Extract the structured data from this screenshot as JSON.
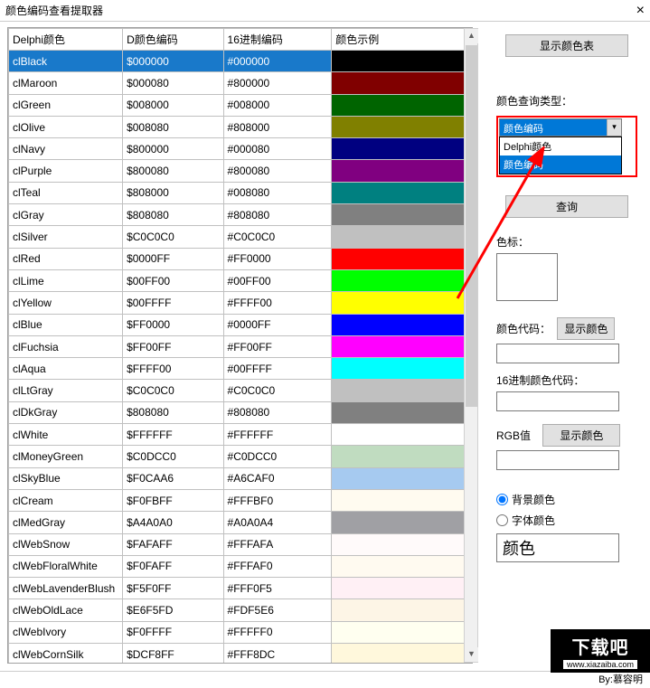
{
  "window": {
    "title": "颜色编码查看提取器",
    "close": "×"
  },
  "table": {
    "headers": [
      "Delphi颜色",
      "D颜色编码",
      "16进制编码",
      "颜色示例"
    ],
    "rows": [
      {
        "name": "clBlack",
        "d": "$000000",
        "hex": "#000000",
        "color": "#000000",
        "selected": true
      },
      {
        "name": "clMaroon",
        "d": "$000080",
        "hex": "#800000",
        "color": "#800000"
      },
      {
        "name": "clGreen",
        "d": "$008000",
        "hex": "#008000",
        "color": "#006400"
      },
      {
        "name": "clOlive",
        "d": "$008080",
        "hex": "#808000",
        "color": "#808000"
      },
      {
        "name": "clNavy",
        "d": "$800000",
        "hex": "#000080",
        "color": "#000080"
      },
      {
        "name": "clPurple",
        "d": "$800080",
        "hex": "#800080",
        "color": "#800080"
      },
      {
        "name": "clTeal",
        "d": "$808000",
        "hex": "#008080",
        "color": "#008080"
      },
      {
        "name": "clGray",
        "d": "$808080",
        "hex": "#808080",
        "color": "#808080"
      },
      {
        "name": "clSilver",
        "d": "$C0C0C0",
        "hex": "#C0C0C0",
        "color": "#C0C0C0"
      },
      {
        "name": "clRed",
        "d": "$0000FF",
        "hex": "#FF0000",
        "color": "#FF0000"
      },
      {
        "name": "clLime",
        "d": "$00FF00",
        "hex": "#00FF00",
        "color": "#00FF00"
      },
      {
        "name": "clYellow",
        "d": "$00FFFF",
        "hex": "#FFFF00",
        "color": "#FFFF00"
      },
      {
        "name": "clBlue",
        "d": "$FF0000",
        "hex": "#0000FF",
        "color": "#0000FF"
      },
      {
        "name": "clFuchsia",
        "d": "$FF00FF",
        "hex": "#FF00FF",
        "color": "#FF00FF"
      },
      {
        "name": "clAqua",
        "d": "$FFFF00",
        "hex": "#00FFFF",
        "color": "#00FFFF"
      },
      {
        "name": "clLtGray",
        "d": "$C0C0C0",
        "hex": "#C0C0C0",
        "color": "#C0C0C0"
      },
      {
        "name": "clDkGray",
        "d": "$808080",
        "hex": "#808080",
        "color": "#808080"
      },
      {
        "name": "clWhite",
        "d": "$FFFFFF",
        "hex": "#FFFFFF",
        "color": "#FFFFFF"
      },
      {
        "name": "clMoneyGreen",
        "d": "$C0DCC0",
        "hex": "#C0DCC0",
        "color": "#C0DCC0"
      },
      {
        "name": "clSkyBlue",
        "d": "$F0CAA6",
        "hex": "#A6CAF0",
        "color": "#A6CAF0"
      },
      {
        "name": "clCream",
        "d": "$F0FBFF",
        "hex": "#FFFBF0",
        "color": "#FFFBF0"
      },
      {
        "name": "clMedGray",
        "d": "$A4A0A0",
        "hex": "#A0A0A4",
        "color": "#A0A0A4"
      },
      {
        "name": "clWebSnow",
        "d": "$FAFAFF",
        "hex": "#FFFAFA",
        "color": "#FFFAFA"
      },
      {
        "name": "clWebFloralWhite",
        "d": "$F0FAFF",
        "hex": "#FFFAF0",
        "color": "#FFFAF0"
      },
      {
        "name": "clWebLavenderBlush",
        "d": "$F5F0FF",
        "hex": "#FFF0F5",
        "color": "#FFF0F5"
      },
      {
        "name": "clWebOldLace",
        "d": "$E6F5FD",
        "hex": "#FDF5E6",
        "color": "#FDF5E6"
      },
      {
        "name": "clWebIvory",
        "d": "$F0FFFF",
        "hex": "#FFFFF0",
        "color": "#FFFFF0"
      },
      {
        "name": "clWebCornSilk",
        "d": "$DCF8FF",
        "hex": "#FFF8DC",
        "color": "#FFF8DC"
      }
    ]
  },
  "panel": {
    "show_table_btn": "显示颜色表",
    "query_type_label": "颜色查询类型：",
    "dropdown_selected": "颜色编码",
    "dropdown_options": [
      "Delphi颜色",
      "颜色编码"
    ],
    "query_btn": "查询",
    "swatch_label": "色标：",
    "color_code_label": "颜色代码：",
    "show_color_btn1": "显示颜色",
    "hex_code_label": "16进制颜色代码：",
    "rgb_label": "RGB值",
    "show_color_btn2": "显示颜色",
    "radio_bg": "背景颜色",
    "radio_font": "字体颜色",
    "preview_text": "颜色"
  },
  "footer": {
    "credit": "By:慕容明"
  },
  "watermark": {
    "top": "下载吧",
    "bot": "www.xiazaiba.com"
  }
}
